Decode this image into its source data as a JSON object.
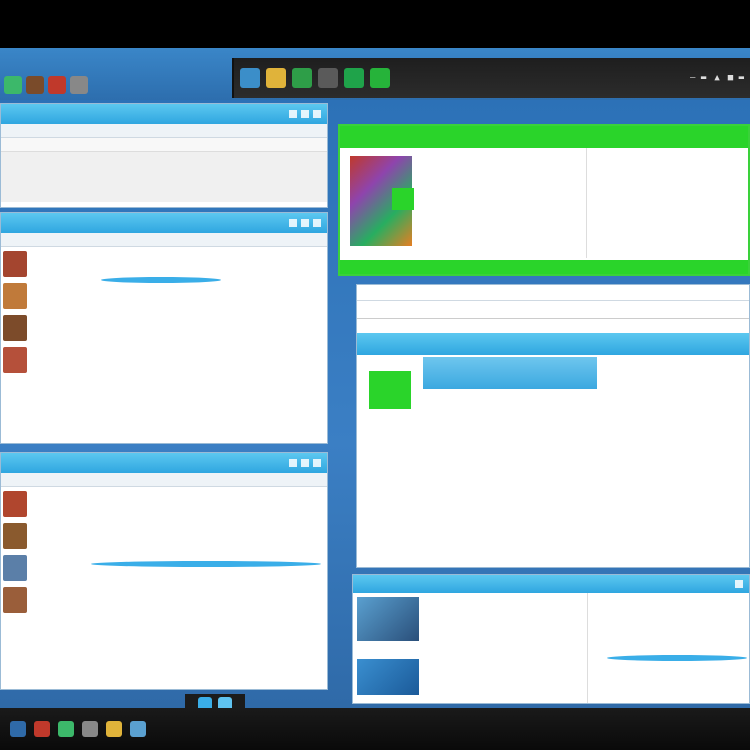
{
  "topbar": {
    "tray": [
      "— ▬",
      "▲",
      "■ ▬"
    ]
  },
  "window1": {
    "title": "",
    "menu": [],
    "address": ""
  },
  "window2": {
    "title": "",
    "menu": []
  },
  "window3": {
    "title": "",
    "menu": []
  },
  "window4": {
    "header": [],
    "lines": [],
    "footer": []
  },
  "window5": {
    "toolbar": [],
    "bar_items": [],
    "rows": []
  },
  "window6": {
    "lines": []
  },
  "dock": {
    "clock": ""
  },
  "colors": {
    "accent_blue": "#2fa6e0",
    "accent_green": "#2ad42a",
    "wallpaper": "#2a6fb5",
    "bar_dark": "#1e1e1e"
  },
  "icons": {
    "shelf": [
      "app-icon",
      "app-icon",
      "app-icon",
      "app-icon"
    ],
    "topbar": [
      "image-icon",
      "folder-icon",
      "leaf-icon",
      "settings-icon",
      "cube-icon",
      "leaf-icon"
    ],
    "dock": [
      "app-icon",
      "app-icon",
      "app-icon",
      "app-icon",
      "app-icon",
      "app-icon"
    ]
  }
}
